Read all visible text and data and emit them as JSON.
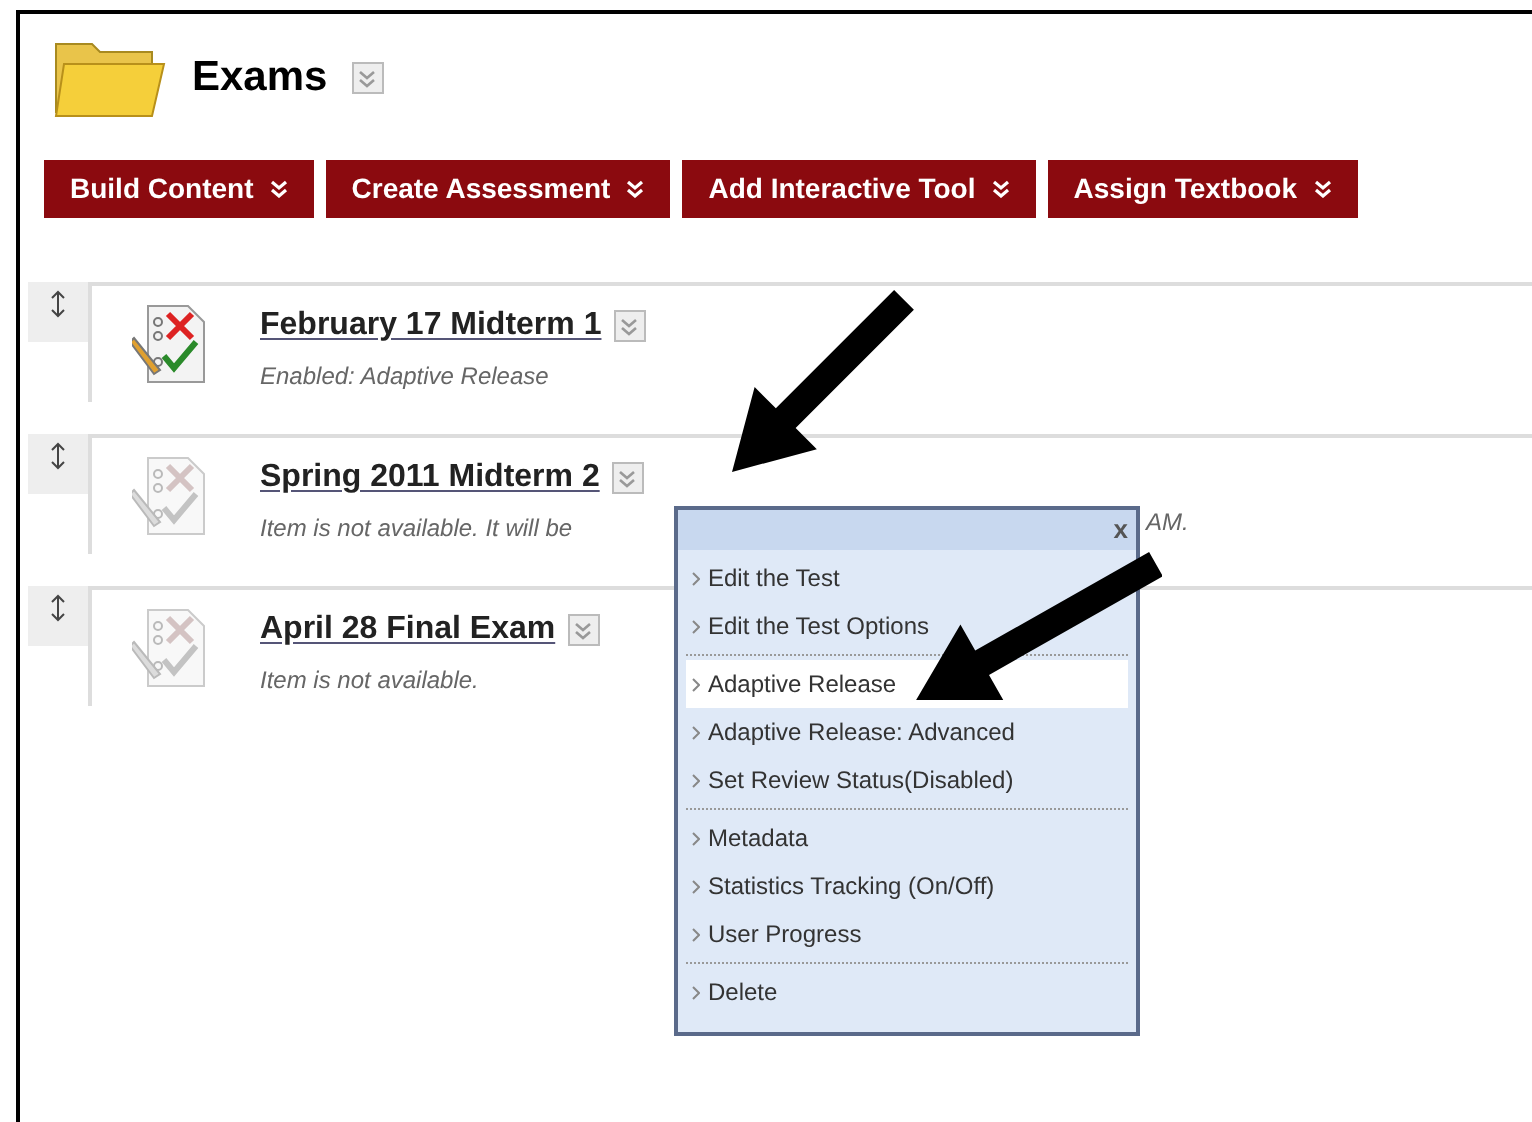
{
  "header": {
    "title": "Exams"
  },
  "toolbar": [
    "Build Content",
    "Create Assessment",
    "Add Interactive Tool",
    "Assign Textbook"
  ],
  "items": [
    {
      "title": "February 17 Midterm 1",
      "available": true,
      "description": "Enabled: Adaptive Release"
    },
    {
      "title": "Spring 2011 Midterm 2",
      "available": false,
      "description": "Item is not available. It will be",
      "description_tail": "AM."
    },
    {
      "title": "April 28 Final Exam",
      "available": false,
      "description": "Item is not available."
    }
  ],
  "context_menu": {
    "close": "x",
    "groups": [
      [
        {
          "label": "Edit the Test",
          "selected": false
        },
        {
          "label": "Edit the Test Options",
          "selected": false
        }
      ],
      [
        {
          "label": "Adaptive Release",
          "selected": true
        },
        {
          "label": "Adaptive Release: Advanced",
          "selected": false
        },
        {
          "label": "Set Review Status(Disabled)",
          "selected": false
        }
      ],
      [
        {
          "label": "Metadata",
          "selected": false
        },
        {
          "label": "Statistics Tracking (On/Off)",
          "selected": false
        },
        {
          "label": "User Progress",
          "selected": false
        }
      ],
      [
        {
          "label": "Delete",
          "selected": false
        }
      ]
    ]
  }
}
